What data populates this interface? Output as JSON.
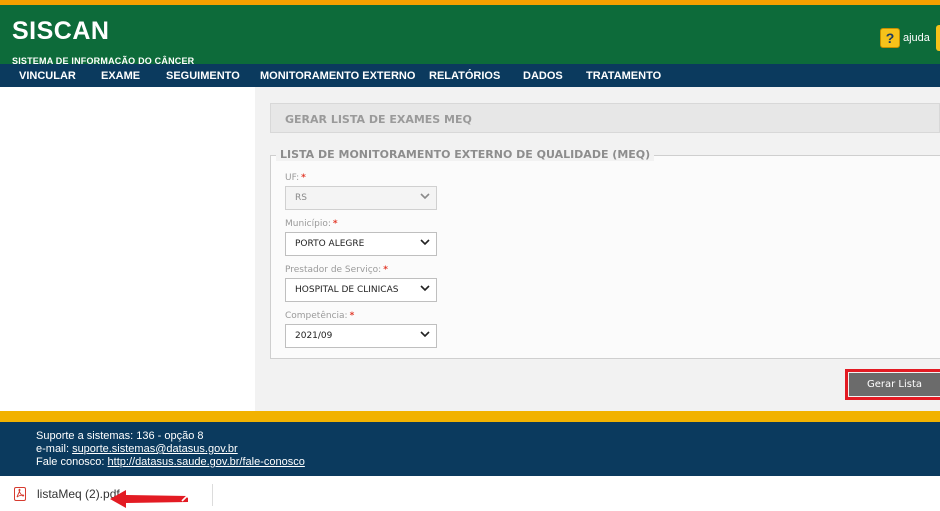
{
  "header": {
    "brand": "SISCAN",
    "subtitle": "SISTEMA DE INFORMAÇÃO DO CÂNCER",
    "help_label": "ajuda",
    "help_icon": "help-icon",
    "colors": {
      "green": "#0d6b3a",
      "blue": "#0b3a5e",
      "orange": "#f5a000"
    }
  },
  "nav": {
    "items": [
      "VINCULAR",
      "EXAME",
      "SEGUIMENTO",
      "MONITORAMENTO EXTERNO",
      "RELATÓRIOS",
      "DADOS",
      "TRATAMENTO"
    ]
  },
  "main": {
    "panel_title": "GERAR LISTA DE EXAMES MEQ",
    "fieldset_legend": "LISTA DE MONITORAMENTO EXTERNO DE QUALIDADE (MEQ)",
    "fields": [
      {
        "label": "UF:",
        "value": "RS"
      },
      {
        "label": "Município:",
        "value": "PORTO ALEGRE"
      },
      {
        "label": "Prestador de Serviço:",
        "value": "HOSPITAL DE CLINICAS"
      },
      {
        "label": "Competência:",
        "value": "2021/09"
      }
    ],
    "required_marker": "*",
    "button_label": "Gerar Lista"
  },
  "footer": {
    "support": "Suporte a sistemas: 136 - opção 8",
    "email_prefix": "e-mail: ",
    "email": "suporte.sistemas@datasus.gov.br",
    "contact_prefix": "Fale conosco: ",
    "contact_url": "http://datasus.saude.gov.br/fale-conosco"
  },
  "download_bar": {
    "filename": "listaMeq (2).pdf"
  }
}
